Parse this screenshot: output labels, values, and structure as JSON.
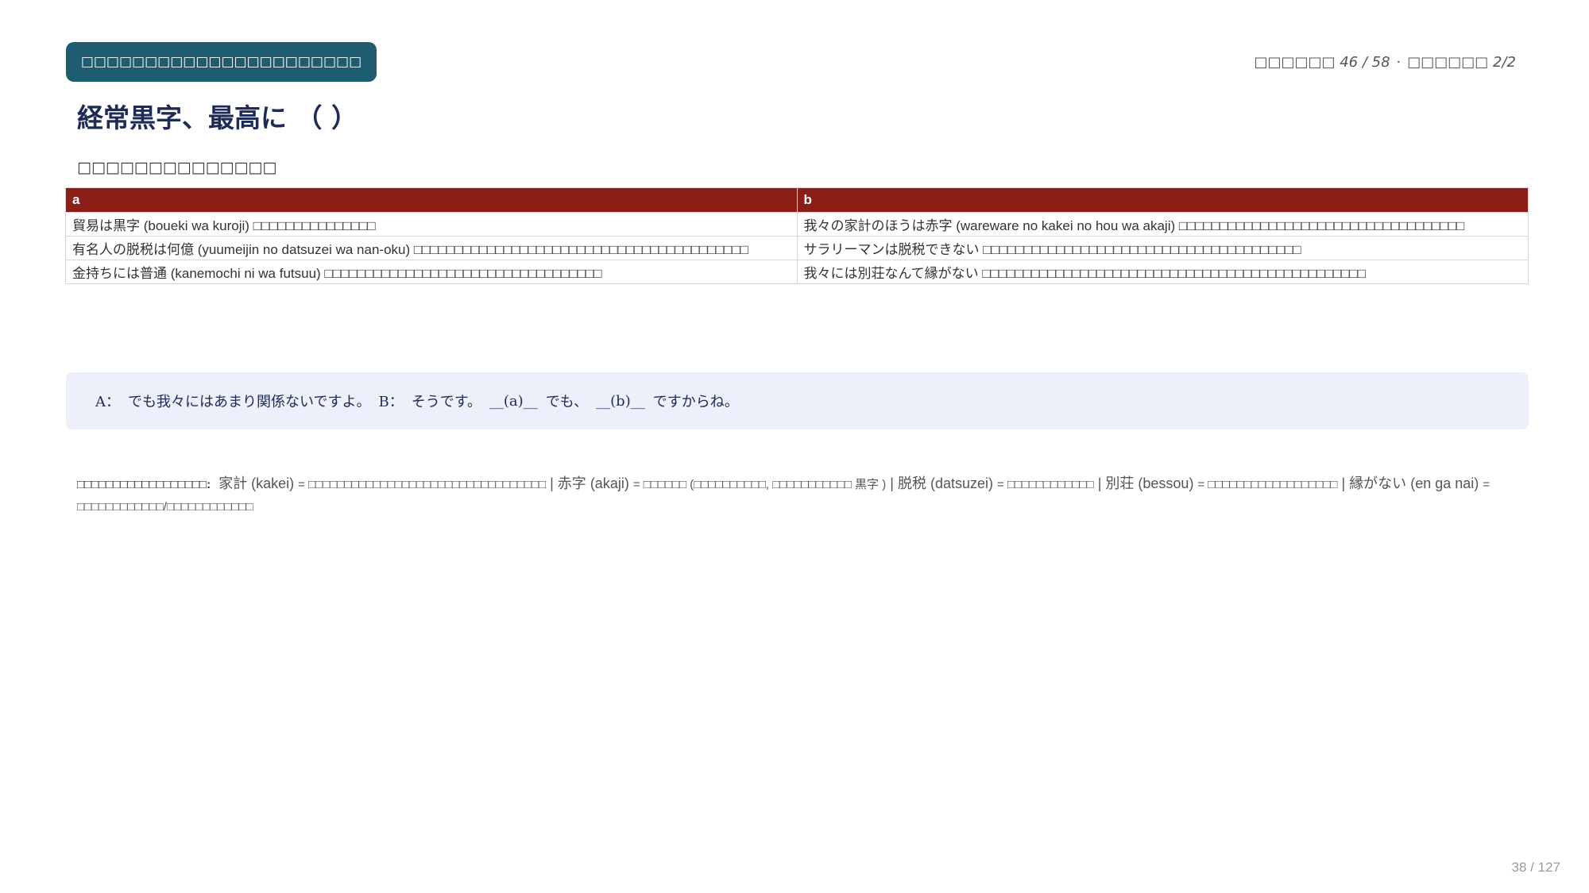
{
  "header": {
    "pill_label": "□□□□□□□□□□□□□□□□□□□□□□",
    "progress_left": "□□□□□□ 46 / 58",
    "progress_sep": "·",
    "progress_right": "□□□□□□ 2/2"
  },
  "title": "経常黒字、最高に （ ）",
  "section_label": "□□□□□□□□□□□□□□",
  "table": {
    "headers": [
      "a",
      "b"
    ],
    "rows": [
      [
        "貿易は黒字 (boueki wa kuroji) □□□□□□□□□□□□□□□",
        "我々の家計のほうは赤字 (wareware no kakei no hou wa akaji) □□□□□□□□□□□□□□□□□□□□□□□□□□□□□□□□□□□"
      ],
      [
        "有名人の脱税は何億 (yuumeijin no datsuzei wa nan-oku) □□□□□□□□□□□□□□□□□□□□□□□□□□□□□□□□□□□□□□□□□",
        "サラリーマンは脱税できない □□□□□□□□□□□□□□□□□□□□□□□□□□□□□□□□□□□□□□□"
      ],
      [
        "金持ちには普通 (kanemochi ni wa futsuu) □□□□□□□□□□□□□□□□□□□□□□□□□□□□□□□□□□",
        "我々には別荘なんて縁がない □□□□□□□□□□□□□□□□□□□□□□□□□□□□□□□□□□□□□□□□□□□□□□□"
      ]
    ]
  },
  "dialogue": {
    "a_label": "A：",
    "a_text": "でも我々にはあまり関係ないですよ。",
    "b_label": "B：",
    "b_text1": "そうです。",
    "blank_a": "__(a)__",
    "middle": "でも、",
    "blank_b": "__(b)__",
    "end": "ですからね。"
  },
  "vocab": {
    "heading": "□□□□□□□□□□□□□□□□□□:",
    "entries": [
      {
        "term": "家計",
        "reading": "(kakei)",
        "definition": "= □□□□□□□□□□□□□□□□□□□□□□□□□□□□□□□□□"
      },
      {
        "term": "赤字",
        "reading": "(akaji)",
        "definition": "= □□□□□□ (□□□□□□□□□□, □□□□□□□□□□□ 黒字 )"
      },
      {
        "term": "脱税",
        "reading": "(datsuzei)",
        "definition": "= □□□□□□□□□□□□"
      },
      {
        "term": "別荘",
        "reading": "(bessou)",
        "definition": "= □□□□□□□□□□□□□□□□□□"
      },
      {
        "term": "縁がない",
        "reading": "(en ga nai)",
        "definition": "= □□□□□□□□□□□□/□□□□□□□□□□□□"
      }
    ],
    "separator": "|"
  },
  "page_number": "38 / 127"
}
